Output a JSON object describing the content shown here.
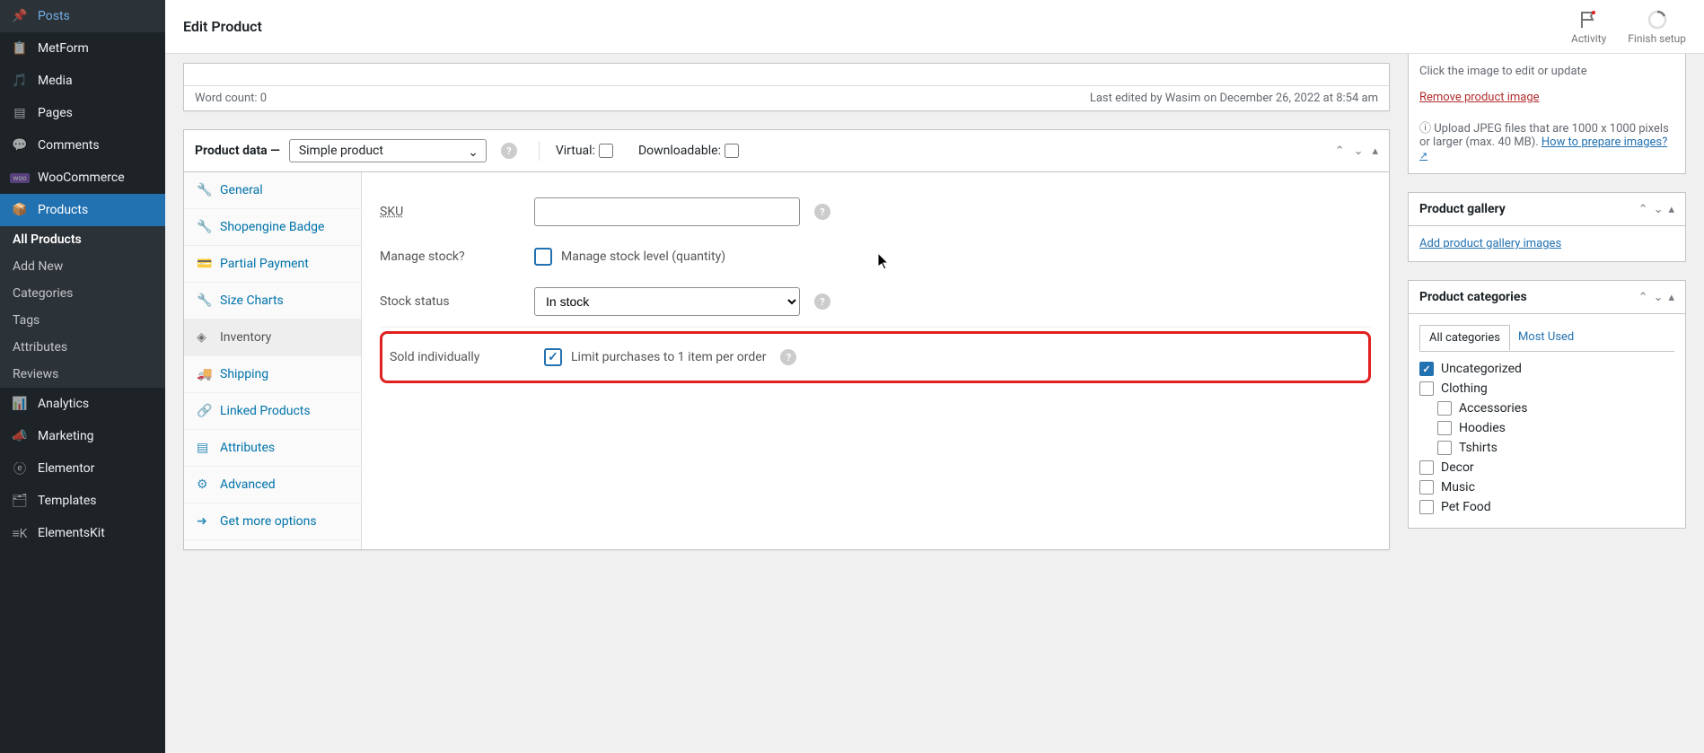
{
  "sidebar": {
    "items": [
      {
        "label": "Posts",
        "icon": "pin"
      },
      {
        "label": "MetForm",
        "icon": "form"
      },
      {
        "label": "Media",
        "icon": "camera"
      },
      {
        "label": "Pages",
        "icon": "pages"
      },
      {
        "label": "Comments",
        "icon": "comment"
      },
      {
        "label": "WooCommerce",
        "icon": "woo"
      },
      {
        "label": "Products",
        "icon": "archive",
        "active": true
      },
      {
        "label": "Analytics",
        "icon": "stats"
      },
      {
        "label": "Marketing",
        "icon": "megaphone"
      },
      {
        "label": "Elementor",
        "icon": "elementor"
      },
      {
        "label": "Templates",
        "icon": "templates"
      },
      {
        "label": "ElementsKit",
        "icon": "ekit"
      }
    ],
    "submenu": [
      {
        "label": "All Products",
        "current": true
      },
      {
        "label": "Add New"
      },
      {
        "label": "Categories"
      },
      {
        "label": "Tags"
      },
      {
        "label": "Attributes"
      },
      {
        "label": "Reviews"
      }
    ]
  },
  "topbar": {
    "title": "Edit Product",
    "activity": "Activity",
    "setup": "Finish setup"
  },
  "editor": {
    "word_count": "Word count: 0",
    "last_edited": "Last edited by Wasim on December 26, 2022 at 8:54 am"
  },
  "product_data": {
    "title": "Product data —",
    "type_select": "Simple product",
    "virtual_label": "Virtual:",
    "downloadable_label": "Downloadable:",
    "tabs": [
      {
        "label": "General",
        "icon": "wrench"
      },
      {
        "label": "Shopengine Badge",
        "icon": "wrench"
      },
      {
        "label": "Partial Payment",
        "icon": "card"
      },
      {
        "label": "Size Charts",
        "icon": "wrench"
      },
      {
        "label": "Inventory",
        "icon": "gear",
        "active": true
      },
      {
        "label": "Shipping",
        "icon": "truck"
      },
      {
        "label": "Linked Products",
        "icon": "link"
      },
      {
        "label": "Attributes",
        "icon": "list"
      },
      {
        "label": "Advanced",
        "icon": "cog"
      },
      {
        "label": "Get more options",
        "icon": "arrow"
      }
    ],
    "inventory": {
      "sku_label": "SKU",
      "sku_value": "",
      "manage_stock_label": "Manage stock?",
      "manage_stock_desc": "Manage stock level (quantity)",
      "stock_status_label": "Stock status",
      "stock_status_value": "In stock",
      "sold_individually_label": "Sold individually",
      "sold_individually_desc": "Limit purchases to 1 item per order",
      "sold_individually_checked": true
    }
  },
  "product_image": {
    "edit_hint": "Click the image to edit or update",
    "remove_link": "Remove product image",
    "upload_hint": "Upload JPEG files that are 1000 x 1000 pixels or larger (max. 40 MB). ",
    "how_to_link": "How to prepare images?"
  },
  "product_gallery": {
    "title": "Product gallery",
    "add_link": "Add product gallery images"
  },
  "product_categories": {
    "title": "Product categories",
    "tabs": [
      "All categories",
      "Most Used"
    ],
    "items": [
      {
        "label": "Uncategorized",
        "checked": true
      },
      {
        "label": "Clothing"
      },
      {
        "label": "Accessories",
        "child": true
      },
      {
        "label": "Hoodies",
        "child": true
      },
      {
        "label": "Tshirts",
        "child": true
      },
      {
        "label": "Decor"
      },
      {
        "label": "Music"
      },
      {
        "label": "Pet Food"
      }
    ]
  }
}
